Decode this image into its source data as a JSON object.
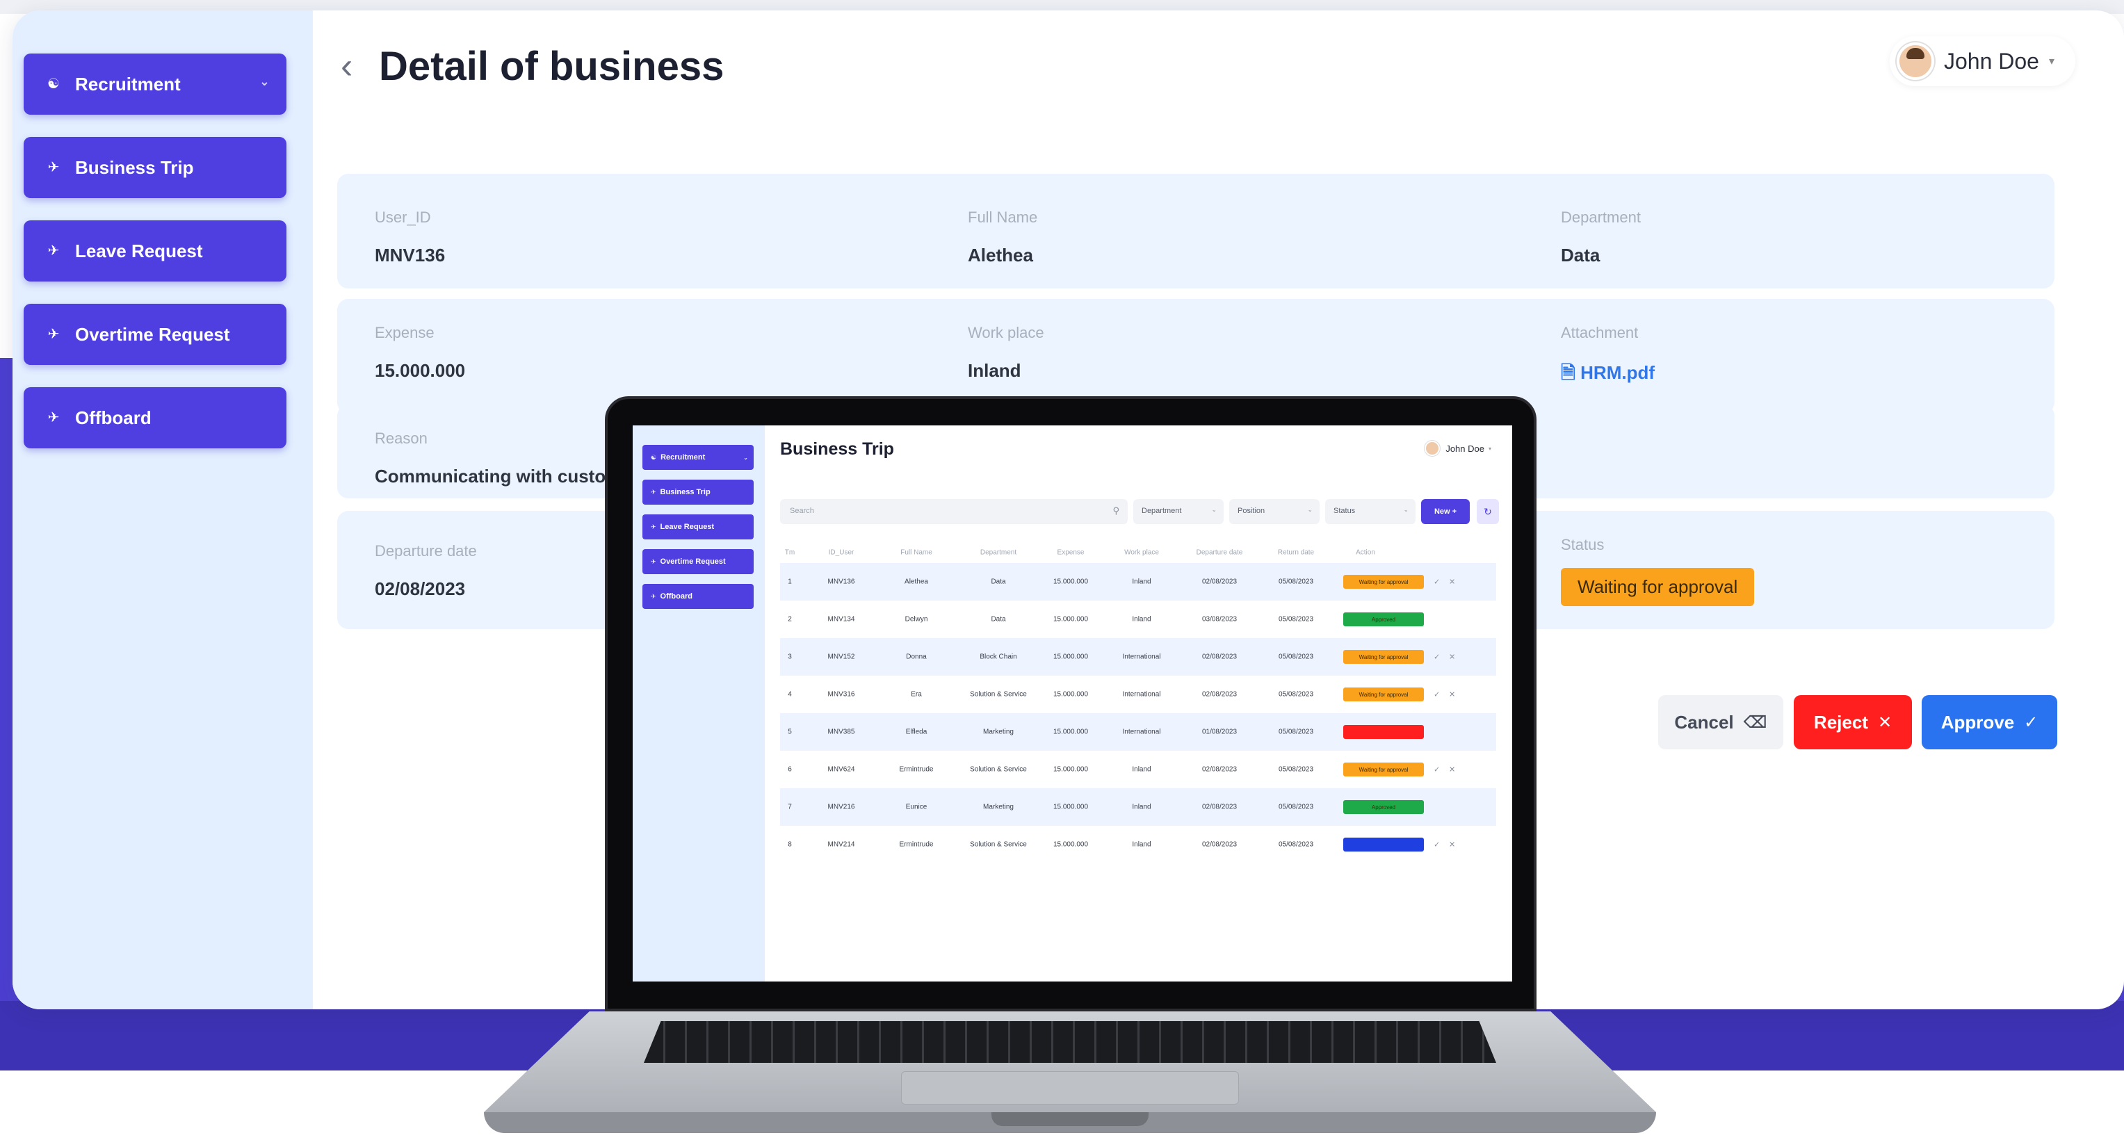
{
  "sidebar": {
    "items": [
      {
        "label": "Recruitment",
        "icon": "users-icon",
        "has_chevron": true
      },
      {
        "label": "Business Trip",
        "icon": "plane-icon"
      },
      {
        "label": "Leave Request",
        "icon": "plane-icon"
      },
      {
        "label": "Overtime Request",
        "icon": "plane-icon"
      },
      {
        "label": "Offboard",
        "icon": "plane-icon"
      }
    ]
  },
  "header": {
    "title": "Detail of business",
    "back_icon": "chevron-left-icon",
    "user_name": "John Doe"
  },
  "details": {
    "user_id": {
      "label": "User_ID",
      "value": "MNV136"
    },
    "full_name": {
      "label": "Full Name",
      "value": "Alethea"
    },
    "department": {
      "label": "Department",
      "value": "Data"
    },
    "expense": {
      "label": "Expense",
      "value": "15.000.000"
    },
    "work_place": {
      "label": "Work place",
      "value": "Inland"
    },
    "attachment": {
      "label": "Attachment",
      "value": "HRM.pdf",
      "icon": "file-icon"
    },
    "reason": {
      "label": "Reason",
      "value": "Communicating with custom"
    },
    "departure_date": {
      "label": "Departure date",
      "value": "02/08/2023"
    },
    "status": {
      "label": "Status",
      "value": "Waiting for approval"
    }
  },
  "actions": {
    "cancel": "Cancel",
    "reject": "Reject",
    "approve": "Approve"
  },
  "colors": {
    "primary": "#4f3fe0",
    "waiting": "#fba21d",
    "approved": "#1faa4a",
    "rejected": "#ff1f1f",
    "completed": "#1f3fe0",
    "approve_button": "#2a73f0"
  },
  "laptop_screen": {
    "title": "Business Trip",
    "user_name": "John Doe",
    "sidebar": [
      "Recruitment",
      "Business Trip",
      "Leave Request",
      "Overtime Request",
      "Offboard"
    ],
    "search_placeholder": "Search",
    "filters": [
      "Department",
      "Position",
      "Status"
    ],
    "new_button": "New +",
    "columns": [
      "Tm",
      "ID_User",
      "Full Name",
      "Department",
      "Expense",
      "Work place",
      "Departure date",
      "Return date",
      "Action"
    ],
    "rows": [
      {
        "n": "1",
        "id": "MNV136",
        "name": "Alethea",
        "dept": "Data",
        "expense": "15.000.000",
        "place": "Inland",
        "dep": "02/08/2023",
        "ret": "05/08/2023",
        "status": "Waiting for approval",
        "status_color": "#fba21d",
        "actions": true
      },
      {
        "n": "2",
        "id": "MNV134",
        "name": "Delwyn",
        "dept": "Data",
        "expense": "15.000.000",
        "place": "Inland",
        "dep": "03/08/2023",
        "ret": "05/08/2023",
        "status": "Approved",
        "status_color": "#1faa4a",
        "actions": false
      },
      {
        "n": "3",
        "id": "MNV152",
        "name": "Donna",
        "dept": "Block Chain",
        "expense": "15.000.000",
        "place": "International",
        "dep": "02/08/2023",
        "ret": "05/08/2023",
        "status": "Waiting for approval",
        "status_color": "#fba21d",
        "actions": true
      },
      {
        "n": "4",
        "id": "MNV316",
        "name": "Era",
        "dept": "Solution & Service",
        "expense": "15.000.000",
        "place": "International",
        "dep": "02/08/2023",
        "ret": "05/08/2023",
        "status": "Waiting for approval",
        "status_color": "#fba21d",
        "actions": true
      },
      {
        "n": "5",
        "id": "MNV385",
        "name": "Elfleda",
        "dept": "Marketing",
        "expense": "15.000.000",
        "place": "International",
        "dep": "01/08/2023",
        "ret": "05/08/2023",
        "status": "",
        "status_color": "#ff1f1f",
        "actions": false
      },
      {
        "n": "6",
        "id": "MNV624",
        "name": "Ermintrude",
        "dept": "Solution & Service",
        "expense": "15.000.000",
        "place": "Inland",
        "dep": "02/08/2023",
        "ret": "05/08/2023",
        "status": "Waiting for approval",
        "status_color": "#fba21d",
        "actions": true
      },
      {
        "n": "7",
        "id": "MNV216",
        "name": "Eunice",
        "dept": "Marketing",
        "expense": "15.000.000",
        "place": "Inland",
        "dep": "02/08/2023",
        "ret": "05/08/2023",
        "status": "Approved",
        "status_color": "#1faa4a",
        "actions": false
      },
      {
        "n": "8",
        "id": "MNV214",
        "name": "Ermintrude",
        "dept": "Solution & Service",
        "expense": "15.000.000",
        "place": "Inland",
        "dep": "02/08/2023",
        "ret": "05/08/2023",
        "status": "",
        "status_color": "#1f3fe0",
        "actions": true
      }
    ]
  }
}
